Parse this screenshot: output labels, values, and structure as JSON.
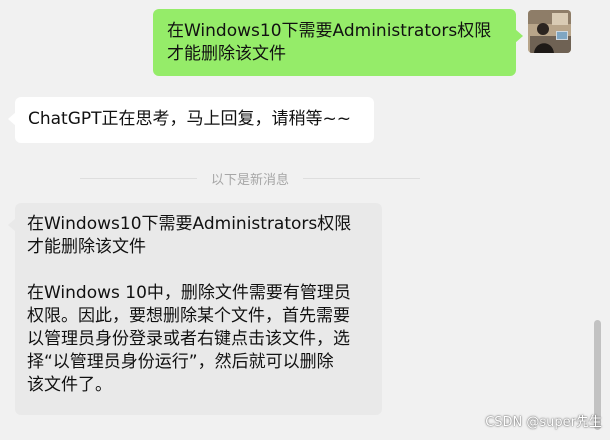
{
  "messages": {
    "outgoing": {
      "line1": "在Windows10下需要Administrators权限",
      "line2": "才能删除该文件"
    },
    "status": {
      "text": "ChatGPT正在思考，马上回复，请稍等~~"
    },
    "divider": {
      "text": "以下是新消息"
    },
    "answer": {
      "q_line1": "在Windows10下需要Administrators权限",
      "q_line2": "才能删除该文件",
      "a_line1": "在Windows 10中，删除文件需要有管理员",
      "a_line2": "权限。因此，要想删除某个文件，首先需要",
      "a_line3": "以管理员身份登录或者右键点击该文件，选",
      "a_line4": "择“以管理员身份运行”，然后就可以删除",
      "a_line5": "该文件了。"
    }
  },
  "watermark": {
    "text": "CSDN @super先生"
  },
  "colors": {
    "background": "#f1f1f1",
    "outgoing_bubble": "#95ec69",
    "status_bubble": "#ffffff",
    "answer_bubble": "#e9e9e9"
  }
}
